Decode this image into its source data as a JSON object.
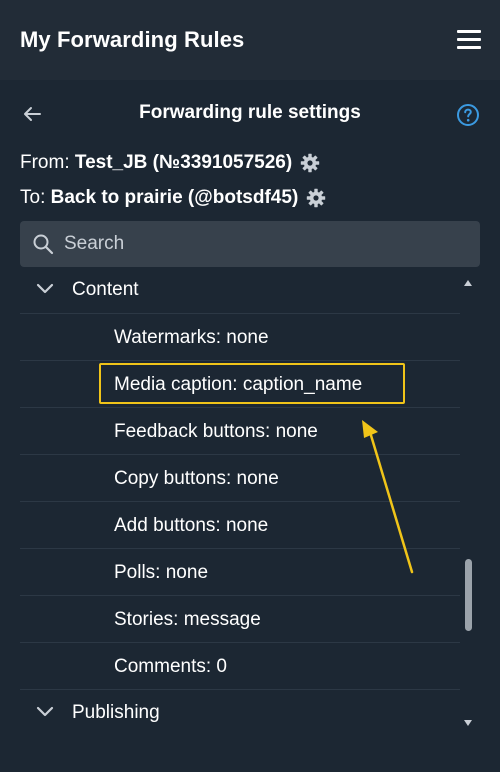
{
  "header": {
    "app_title": "My Forwarding Rules",
    "menu_icon": "hamburger-menu-icon"
  },
  "subheader": {
    "title": "Forwarding rule settings",
    "back_icon": "arrow-left-icon",
    "help_icon": "question-circle-icon"
  },
  "route": {
    "from_prefix": "From:",
    "from_value": "Test_JB (№3391057526)",
    "to_prefix": "To:",
    "to_value": "Back to prairie (@botsdf45)",
    "settings_icon": "gear-icon"
  },
  "search": {
    "placeholder": "Search",
    "value": ""
  },
  "settings": {
    "sections": [
      {
        "label": "Content",
        "expanded": true,
        "items": [
          {
            "label": "Watermarks: none"
          },
          {
            "label": "Media caption: caption_name",
            "highlighted": true
          },
          {
            "label": "Feedback buttons: none"
          },
          {
            "label": "Copy buttons: none"
          },
          {
            "label": "Add buttons: none"
          },
          {
            "label": "Polls: none"
          },
          {
            "label": "Stories: message"
          },
          {
            "label": "Comments: 0"
          }
        ]
      },
      {
        "label": "Publishing",
        "expanded": true,
        "items": []
      }
    ]
  },
  "colors": {
    "background": "#1c2733",
    "topbar": "#222c37",
    "search_bg": "#37414c",
    "highlight": "#f0c419",
    "help_icon": "#3b9ae1",
    "divider": "#2c3845"
  }
}
